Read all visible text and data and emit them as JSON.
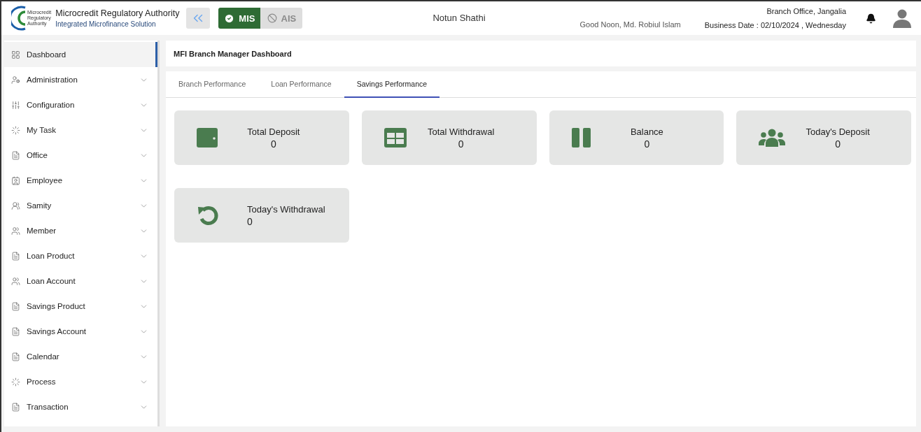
{
  "header": {
    "logo_text": [
      "Microcredit",
      "Regulatory",
      "Authority"
    ],
    "org_title": "Microcredit Regulatory Authority",
    "org_subtitle": "Integrated Microfinance Solution",
    "modules": [
      {
        "label": "MIS",
        "selected": true
      },
      {
        "label": "AIS",
        "selected": false
      }
    ],
    "app_name": "Notun Shathi",
    "greeting": "Good Noon, Md. Robiul Islam",
    "branch": "Branch Office, Jangalia",
    "business_date": "Business Date : 02/10/2024 , Wednesday"
  },
  "sidebar": {
    "items": [
      {
        "label": "Dashboard",
        "kind": "grid",
        "selected": true,
        "has_children": false
      },
      {
        "label": "Administration",
        "kind": "admin",
        "selected": false,
        "has_children": true
      },
      {
        "label": "Configuration",
        "kind": "sliders",
        "selected": false,
        "has_children": true
      },
      {
        "label": "My Task",
        "kind": "cycle",
        "selected": false,
        "has_children": true
      },
      {
        "label": "Office",
        "kind": "doc",
        "selected": false,
        "has_children": true
      },
      {
        "label": "Employee",
        "kind": "badge",
        "selected": false,
        "has_children": true
      },
      {
        "label": "Samity",
        "kind": "group",
        "selected": false,
        "has_children": true
      },
      {
        "label": "Member",
        "kind": "people",
        "selected": false,
        "has_children": true
      },
      {
        "label": "Loan Product",
        "kind": "doc",
        "selected": false,
        "has_children": true
      },
      {
        "label": "Loan Account",
        "kind": "people",
        "selected": false,
        "has_children": true
      },
      {
        "label": "Savings Product",
        "kind": "doc",
        "selected": false,
        "has_children": true
      },
      {
        "label": "Savings Account",
        "kind": "doc",
        "selected": false,
        "has_children": true
      },
      {
        "label": "Calendar",
        "kind": "doc",
        "selected": false,
        "has_children": true
      },
      {
        "label": "Process",
        "kind": "cycle",
        "selected": false,
        "has_children": true
      },
      {
        "label": "Transaction",
        "kind": "doc",
        "selected": false,
        "has_children": true
      }
    ]
  },
  "page_title": "MFI Branch Manager Dashboard",
  "tabs": [
    {
      "label": "Branch Performance",
      "selected": false
    },
    {
      "label": "Loan Performance",
      "selected": false
    },
    {
      "label": "Savings Performance",
      "selected": true
    }
  ],
  "cards": [
    {
      "label": "Total Deposit",
      "value": "0",
      "kind": "wallet"
    },
    {
      "label": "Total Withdrawal",
      "value": "0",
      "kind": "table"
    },
    {
      "label": "Balance",
      "value": "0",
      "kind": "pause"
    },
    {
      "label": "Today's Deposit",
      "value": "0",
      "kind": "users"
    },
    {
      "label": "Today's Withdrawal",
      "value": "0",
      "kind": "undo"
    }
  ]
}
